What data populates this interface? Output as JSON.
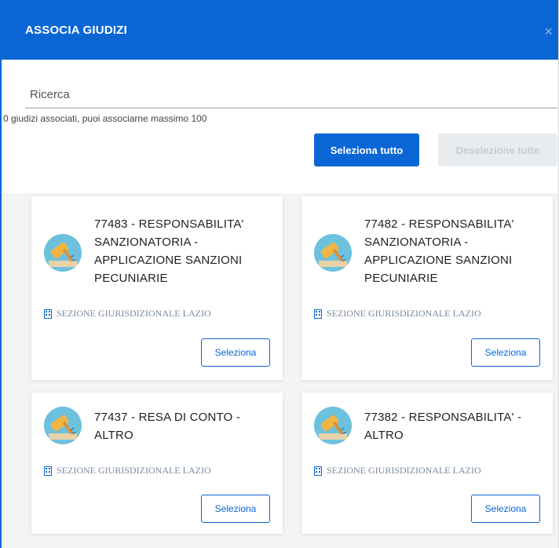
{
  "dialog": {
    "title": "ASSOCIA GIUDIZI",
    "close_glyph": "×"
  },
  "search": {
    "placeholder": "Ricerca",
    "info": "0 giudizi associati, puoi associarne massimo 100"
  },
  "actions": {
    "select_all": "Seleziona tutto",
    "deselect_all": "Deselezione tutte"
  },
  "cards": [
    {
      "title": "77483 - RESPONSABILITA' SANZIONATORIA - APPLICAZIONE SANZIONI PECUNIARIE",
      "section": "SEZIONE GIURISDIZIONALE LAZIO",
      "button": "Seleziona",
      "icon": "gavel-icon"
    },
    {
      "title": "77482 - RESPONSABILITA' SANZIONATORIA - APPLICAZIONE SANZIONI PECUNIARIE",
      "section": "SEZIONE GIURISDIZIONALE LAZIO",
      "button": "Seleziona",
      "icon": "gavel-icon"
    },
    {
      "title": "77437 - RESA DI CONTO - ALTRO",
      "section": "SEZIONE GIURISDIZIONALE LAZIO",
      "button": "Seleziona",
      "icon": "gavel-icon"
    },
    {
      "title": "77382 - RESPONSABILITA' - ALTRO",
      "section": "SEZIONE GIURISDIZIONALE LAZIO",
      "button": "Seleziona",
      "icon": "gavel-icon"
    }
  ],
  "colors": {
    "primary": "#0a66d4",
    "section_text": "#7a8ba0",
    "avatar_bg": "#6ec1dd"
  }
}
